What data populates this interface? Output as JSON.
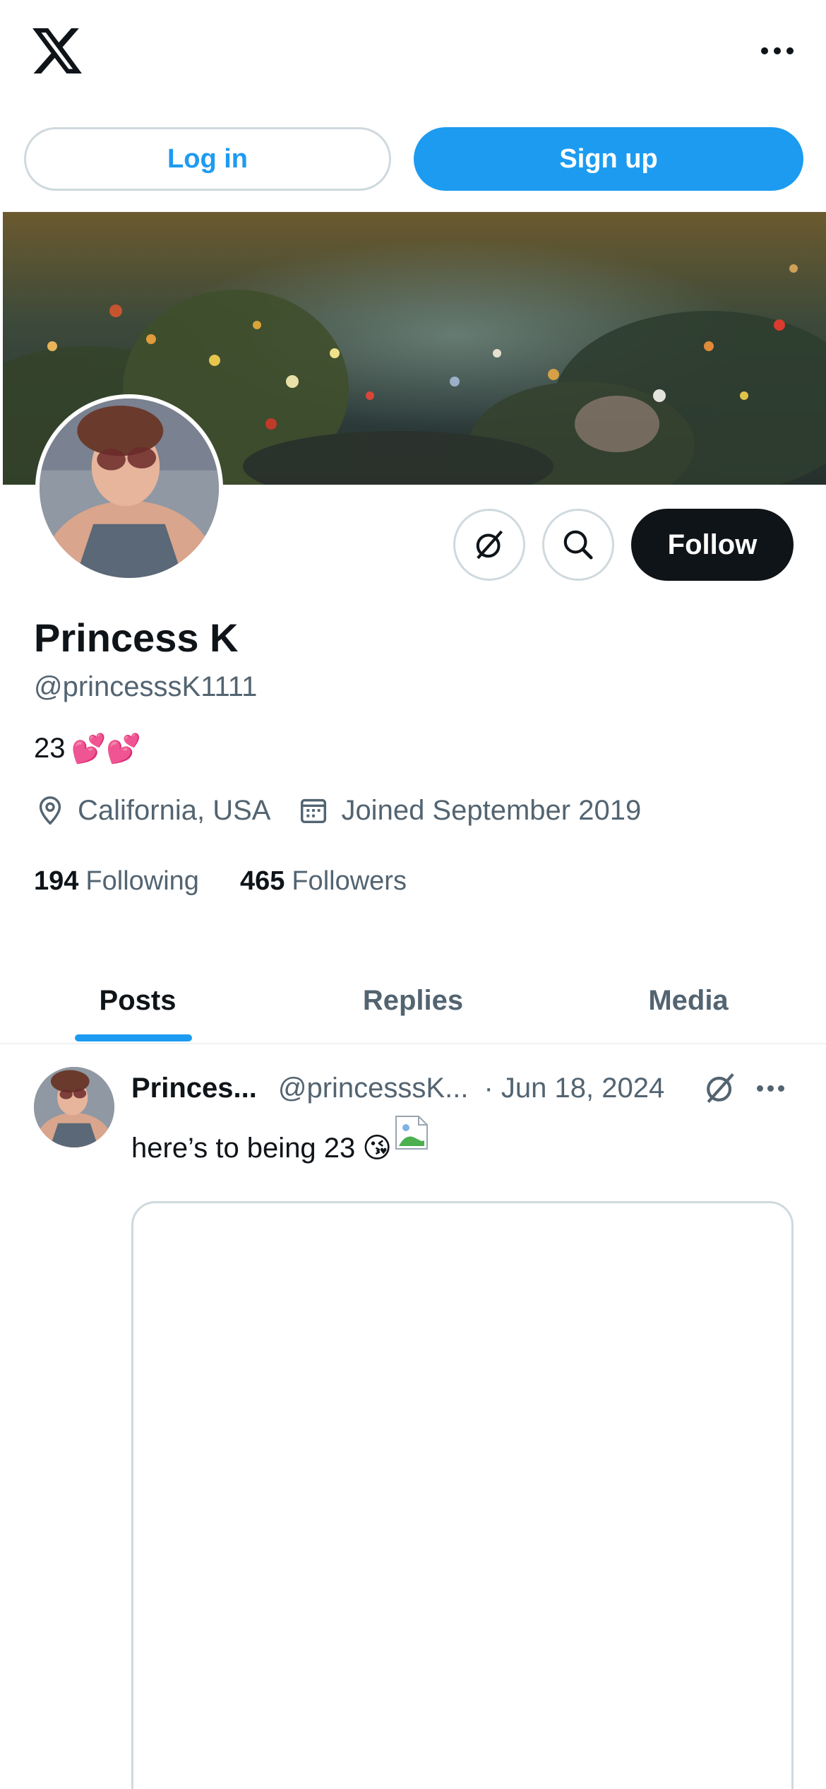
{
  "header": {
    "logo": "x-logo-icon",
    "more": "more-icon"
  },
  "auth": {
    "login_label": "Log in",
    "signup_label": "Sign up"
  },
  "profile": {
    "name": "Princess K",
    "handle": "@princesssK1111",
    "bio_text": "23",
    "bio_emoji": "💕💕",
    "location": "California, USA",
    "joined": "Joined September 2019",
    "following_count": "194",
    "following_label": "Following",
    "followers_count": "465",
    "followers_label": "Followers",
    "follow_label": "Follow"
  },
  "tabs": [
    {
      "label": "Posts",
      "active": true
    },
    {
      "label": "Replies",
      "active": false
    },
    {
      "label": "Media",
      "active": false
    }
  ],
  "post": {
    "name": "Princes...",
    "handle": "@princesssK...",
    "date": "· Jun 18, 2024",
    "text": "here’s to being 23",
    "emoji": "😘"
  },
  "colors": {
    "accent": "#1d9bf0",
    "text": "#0f1419",
    "secondary": "#536471",
    "border": "#cfd9de"
  }
}
